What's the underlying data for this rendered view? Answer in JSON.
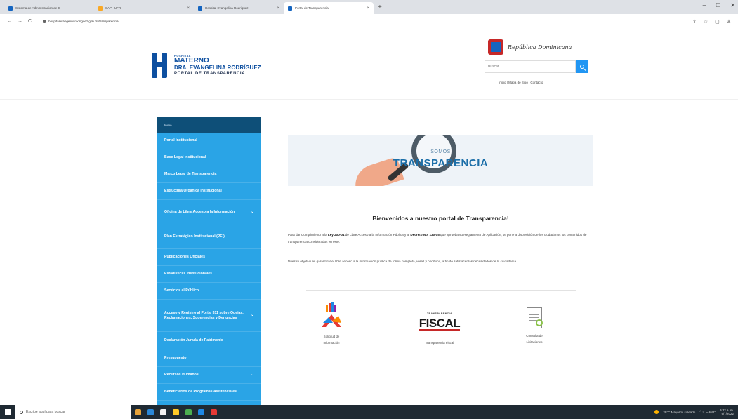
{
  "browser": {
    "tabs": [
      {
        "label": "Sistema de Administracion de C",
        "active": false
      },
      {
        "label": "SAP - UFR",
        "active": false
      },
      {
        "label": "Hospital Evangelina Rodriguez",
        "active": false
      },
      {
        "label": "Portal de Transparencia",
        "active": true
      }
    ],
    "new_tab": "+",
    "window_controls": [
      "–",
      "☐",
      "✕"
    ],
    "url": "hospitalevangelinarodriguez.gob.do/transparencia/",
    "nav_icons": [
      "←",
      "→",
      "C"
    ],
    "right_icons": [
      "⇪",
      "☆",
      "▢",
      "♙"
    ]
  },
  "header": {
    "logo": {
      "small": "HOSPITAL",
      "line1": "MATERNO",
      "line2": "DRA. EVANGELINA RODRÍGUEZ",
      "line3": "PORTAL DE TRANSPARENCIA"
    },
    "gov_label": "República Dominicana",
    "search_placeholder": "Buscar...",
    "links": "Inicio | Mapa de Sitio | Contacto"
  },
  "sidebar": {
    "head": "Inicio",
    "items": [
      {
        "label": "Portal Institucional",
        "chevron": false
      },
      {
        "label": "Base Legal Institucional",
        "chevron": false
      },
      {
        "label": "Marco Legal de Transparencia",
        "chevron": false
      },
      {
        "label": "Estructura Orgánica Institucional",
        "chevron": false
      },
      {
        "label": "Oficina de Libre Acceso a la Información",
        "chevron": true
      },
      {
        "label": "Plan Estratégico Institucional (PEI)",
        "chevron": false
      },
      {
        "label": "Publicaciones Oficiales",
        "chevron": false
      },
      {
        "label": "Estadísticas Institucionales",
        "chevron": false
      },
      {
        "label": "Servicios al Público",
        "chevron": false
      },
      {
        "label": "Acceso y Registro al Portal 311 sobre Quejas, Reclamaciones, Sugerencias y Denuncias",
        "chevron": true
      },
      {
        "label": "Declaración Jurada de Patrimonio",
        "chevron": false
      },
      {
        "label": "Presupuesto",
        "chevron": false
      },
      {
        "label": "Recursos Humanos",
        "chevron": true
      },
      {
        "label": "Beneficiarios de Programas Asistenciales",
        "chevron": false
      }
    ],
    "chevron_glyph": "⌄"
  },
  "main": {
    "banner_top": "SOMOS",
    "banner_main": "TRANSPARENCIA",
    "welcome": "Bienvenidos a nuestro portal de Transparencia!",
    "para1_a": "Para dar Cumplimiento a la ",
    "para1_law1": "Ley 200-04",
    "para1_b": " de Libre Acceso a la Información Pública y al ",
    "para1_law2": "Decreto No. 130-05",
    "para1_c": " que aprueba su Reglamento de Aplicación, se pone a disposición de los ciudadanos los contenidos de transparencia considerados en éste.",
    "para2": "Nuestro objetivo es garantizar el libre acceso a la información pública de forma completa, veraz y oportuna, a fin de satisfacer las necesidades de la ciudadanía.",
    "icons": {
      "solicitud": "Solicitud de Información",
      "fiscal_small": "TRANSPARENCIA",
      "fiscal_big": "FISCAL",
      "fiscal_label": "Transparencia Fiscal",
      "consulta": "Consulta de Licitaciones"
    }
  },
  "taskbar": {
    "search_placeholder": "Escribe aquí para buscar",
    "apps": [
      "#e7a33a",
      "#2b88d8",
      "#f2f2f2",
      "#ffca28",
      "#4caf50",
      "#1e88e5",
      "#e53935"
    ],
    "weather": "29°C  Mayorm. soleado",
    "tray_text": "^  ☼  ⊏  ESP",
    "time": "9:22 a. m.",
    "date": "9/7/2022"
  }
}
